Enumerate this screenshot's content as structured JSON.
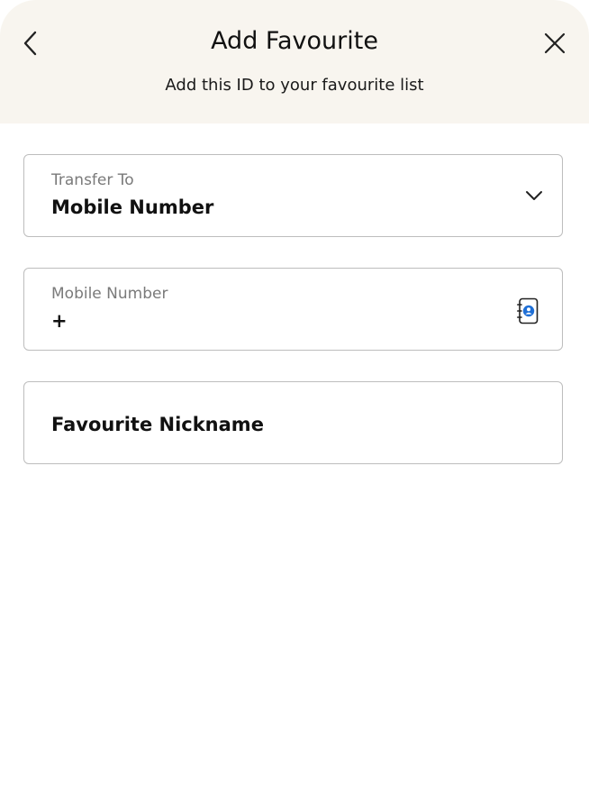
{
  "header": {
    "title": "Add Favourite",
    "subtitle": "Add this ID to your favourite list",
    "back_icon": "chevron-left-icon",
    "close_icon": "close-icon"
  },
  "transfer_to": {
    "label": "Transfer To",
    "value": "Mobile Number",
    "icon": "chevron-down-icon"
  },
  "mobile_number": {
    "label": "Mobile Number",
    "value": "+",
    "icon": "contact-book-icon"
  },
  "nickname": {
    "placeholder": "Favourite Nickname"
  },
  "colors": {
    "header_bg": "#f8f5ef",
    "border": "#bdbdbd",
    "label": "#7a7a7a",
    "accent": "#1f6fd6"
  }
}
